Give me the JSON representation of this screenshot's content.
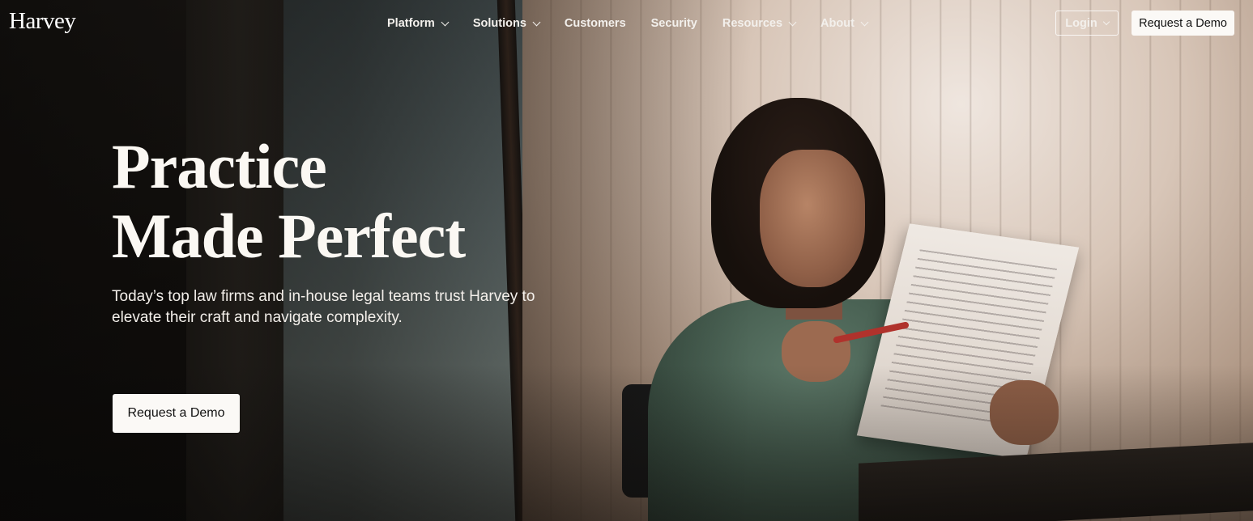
{
  "brand": {
    "logo_text": "Harvey"
  },
  "nav": {
    "items": [
      {
        "label": "Platform",
        "has_dropdown": true
      },
      {
        "label": "Solutions",
        "has_dropdown": true
      },
      {
        "label": "Customers",
        "has_dropdown": false
      },
      {
        "label": "Security",
        "has_dropdown": false
      },
      {
        "label": "Resources",
        "has_dropdown": true
      },
      {
        "label": "About",
        "has_dropdown": true
      }
    ],
    "login_label": "Login",
    "demo_label": "Request a Demo"
  },
  "hero": {
    "headline_line1": "Practice",
    "headline_line2": "Made Perfect",
    "subcopy_line1": "Today’s top law firms and in-house legal teams trust Harvey to",
    "subcopy_line2": "elevate their craft and navigate complexity.",
    "cta_label": "Request a Demo"
  },
  "colors": {
    "text_light": "#fbf8f3",
    "button_bg": "#fbf9f6",
    "button_text": "#111111"
  }
}
